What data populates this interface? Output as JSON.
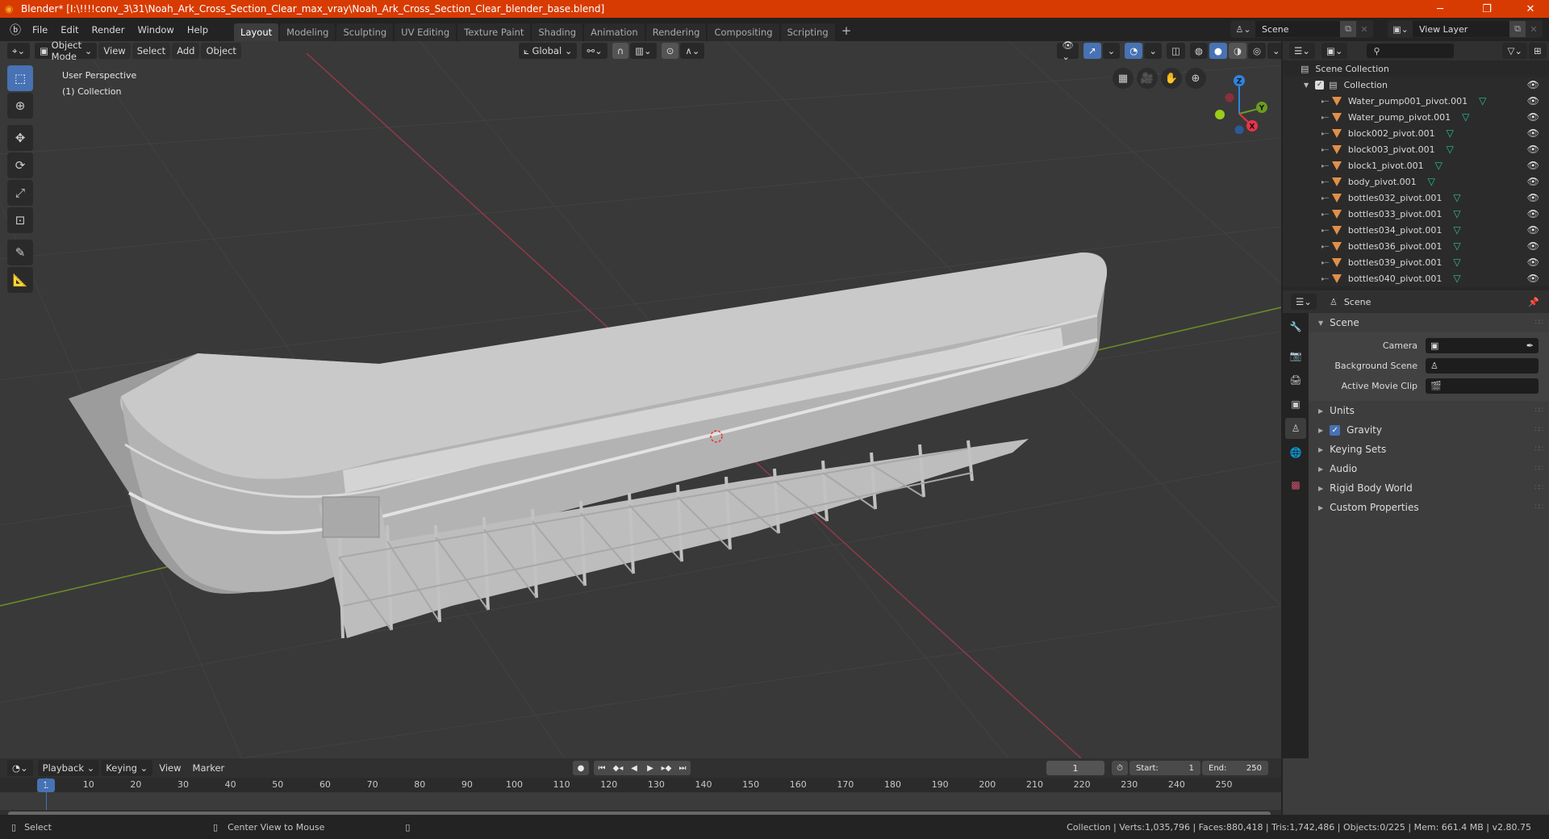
{
  "window": {
    "title": "Blender* [I:\\!!!!conv_3\\31\\Noah_Ark_Cross_Section_Clear_max_vray\\Noah_Ark_Cross_Section_Clear_blender_base.blend]",
    "minimize": "─",
    "maximize": "❐",
    "close": "✕"
  },
  "topbar": {
    "menus": [
      "File",
      "Edit",
      "Render",
      "Window",
      "Help"
    ],
    "workspaces": [
      "Layout",
      "Modeling",
      "Sculpting",
      "UV Editing",
      "Texture Paint",
      "Shading",
      "Animation",
      "Rendering",
      "Compositing",
      "Scripting"
    ],
    "active_workspace": "Layout",
    "add_workspace": "+",
    "scene_name": "Scene",
    "view_layer_name": "View Layer"
  },
  "viewport": {
    "mode": "Object Mode",
    "menus": [
      "View",
      "Select",
      "Add",
      "Object"
    ],
    "transform_orientation": "Global",
    "perspective_label": "User Perspective",
    "collection_label": "(1) Collection",
    "gizmo_axes": {
      "x": "X",
      "y": "Y",
      "z": "Z"
    },
    "colors": {
      "x_axis": "#8b3a4a",
      "y_axis": "#6a8a2a",
      "gizmo_x": "#e8334a",
      "gizmo_y": "#6c9b22",
      "gizmo_z": "#2f83e0"
    }
  },
  "outliner": {
    "root": "Scene Collection",
    "collection": "Collection",
    "items": [
      "Water_pump001_pivot.001",
      "Water_pump_pivot.001",
      "block002_pivot.001",
      "block003_pivot.001",
      "block1_pivot.001",
      "body_pivot.001",
      "bottles032_pivot.001",
      "bottles033_pivot.001",
      "bottles034_pivot.001",
      "bottles036_pivot.001",
      "bottles039_pivot.001",
      "bottles040_pivot.001"
    ]
  },
  "properties": {
    "context": "Scene",
    "panel_title": "Scene",
    "fields": [
      {
        "label": "Camera",
        "value": ""
      },
      {
        "label": "Background Scene",
        "value": ""
      },
      {
        "label": "Active Movie Clip",
        "value": ""
      }
    ],
    "collapsed_panels": [
      "Units",
      "Gravity",
      "Keying Sets",
      "Audio",
      "Rigid Body World",
      "Custom Properties"
    ],
    "gravity_enabled": true
  },
  "timeline": {
    "menus": [
      "Playback",
      "Keying",
      "View",
      "Marker"
    ],
    "current_frame": "1",
    "start_label": "Start:",
    "start": "1",
    "end_label": "End:",
    "end": "250",
    "ruler": [
      "1",
      "10",
      "20",
      "30",
      "40",
      "50",
      "60",
      "70",
      "80",
      "90",
      "100",
      "110",
      "120",
      "130",
      "140",
      "150",
      "160",
      "170",
      "180",
      "190",
      "200",
      "210",
      "220",
      "230",
      "240",
      "250"
    ]
  },
  "statusbar": {
    "left_action": "Select",
    "middle_action": "Center View to Mouse",
    "stats": "Collection | Verts:1,035,796 | Faces:880,418 | Tris:1,742,486 | Objects:0/225 | Mem: 661.4 MB | v2.80.75"
  }
}
